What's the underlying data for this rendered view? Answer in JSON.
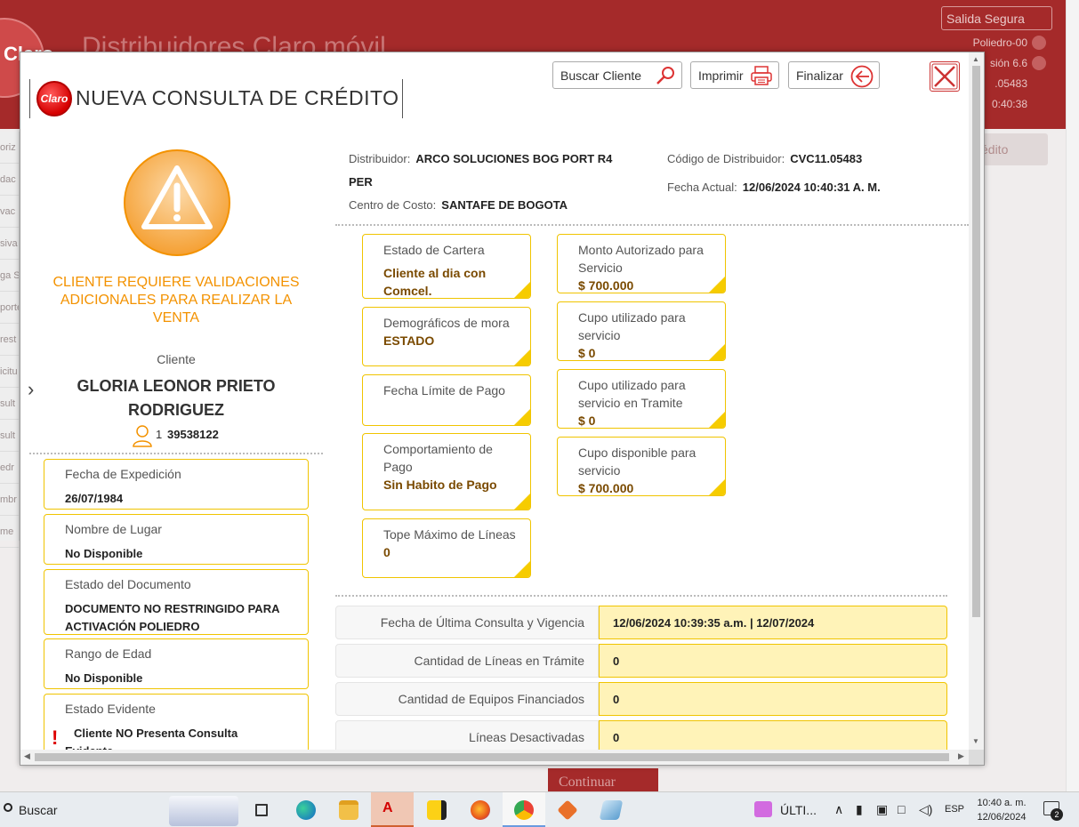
{
  "background": {
    "app_title": "Distribuidores Claro móvil",
    "logo_text": "Claro",
    "salida_segura": "Salida Segura",
    "info_lines": [
      "Poliedro-00",
      "sión 6.6",
      ".05483",
      "0:40:38"
    ],
    "right_panel_label": "édito",
    "left_nav": [
      "oriz",
      "dac",
      "vac",
      "siva",
      "ga S",
      "porte",
      "rest",
      "icitu",
      "sult",
      "sult",
      "edr",
      "mbr",
      "me"
    ],
    "continuar_label": "Continuar"
  },
  "modal": {
    "logo_text": "Claro",
    "title": "NUEVA CONSULTA DE CRÉDITO",
    "buttons": {
      "buscar": "Buscar Cliente",
      "imprimir": "Imprimir",
      "finalizar": "Finalizar"
    },
    "warning_text": "CLIENTE REQUIERE VALIDACIONES ADICIONALES PARA REALIZAR LA VENTA",
    "cliente": {
      "label": "Cliente",
      "name": "GLORIA LEONOR PRIETO RODRIGUEZ",
      "id_prefix": "1",
      "id": "39538122"
    },
    "left_cards": [
      {
        "label": "Fecha de Expedición",
        "value": "26/07/1984"
      },
      {
        "label": "Nombre de Lugar",
        "value": "No Disponible"
      },
      {
        "label": "Estado del Documento",
        "value": "DOCUMENTO NO RESTRINGIDO PARA ACTIVACIÓN POLIEDRO"
      },
      {
        "label": "Rango de Edad",
        "value": "No Disponible"
      },
      {
        "label": "Estado Evidente",
        "value": "Cliente NO Presenta Consulta Evidente"
      }
    ],
    "info": {
      "distribuidor_label": "Distribuidor:",
      "distribuidor_value": "ARCO SOLUCIONES BOG PORT R4",
      "distribuidor_value_2": "PER",
      "centro_label": "Centro de Costo:",
      "centro_value": "SANTAFE DE BOGOTA",
      "codigo_label": "Código de Distribuidor:",
      "codigo_value": "CVC11.05483",
      "fecha_label": "Fecha Actual:",
      "fecha_value": "12/06/2024 10:40:31 A. M."
    },
    "cards_col1": [
      {
        "label": "Estado de Cartera",
        "value": "Cliente al dia con Comcel."
      },
      {
        "label": "Demográficos de mora",
        "value": "ESTADO"
      },
      {
        "label": "Fecha Límite de Pago",
        "value": ""
      },
      {
        "label": "Comportamiento de Pago",
        "value": "Sin Habito de Pago"
      },
      {
        "label": "Tope Máximo de Líneas",
        "value": "0"
      }
    ],
    "cards_col2": [
      {
        "label": "Monto Autorizado para Servicio",
        "value": "$ 700.000"
      },
      {
        "label": "Cupo utilizado para servicio",
        "value": "$ 0"
      },
      {
        "label": "Cupo utilizado para servicio en Tramite",
        "value": "$ 0"
      },
      {
        "label": "Cupo disponible para servicio",
        "value": "$ 700.000"
      }
    ],
    "table_rows": [
      {
        "label": "Fecha de Última Consulta y Vigencia",
        "value": "12/06/2024 10:39:35 a.m. | 12/07/2024"
      },
      {
        "label": "Cantidad de Líneas en Trámite",
        "value": "0"
      },
      {
        "label": "Cantidad de Equipos Financiados",
        "value": "0"
      },
      {
        "label": "Líneas Desactivadas",
        "value": "0"
      }
    ]
  },
  "taskbar": {
    "search": "Buscar",
    "ulti_label": "ÚLTI...",
    "lang": "ESP",
    "time": "10:40 a. m.",
    "date": "12/06/2024",
    "notifications": "2"
  },
  "colors": {
    "brand_red": "#a52a2a",
    "warning_orange": "#f39200",
    "card_border": "#f0c400",
    "value_bg": "#fff3b8"
  }
}
